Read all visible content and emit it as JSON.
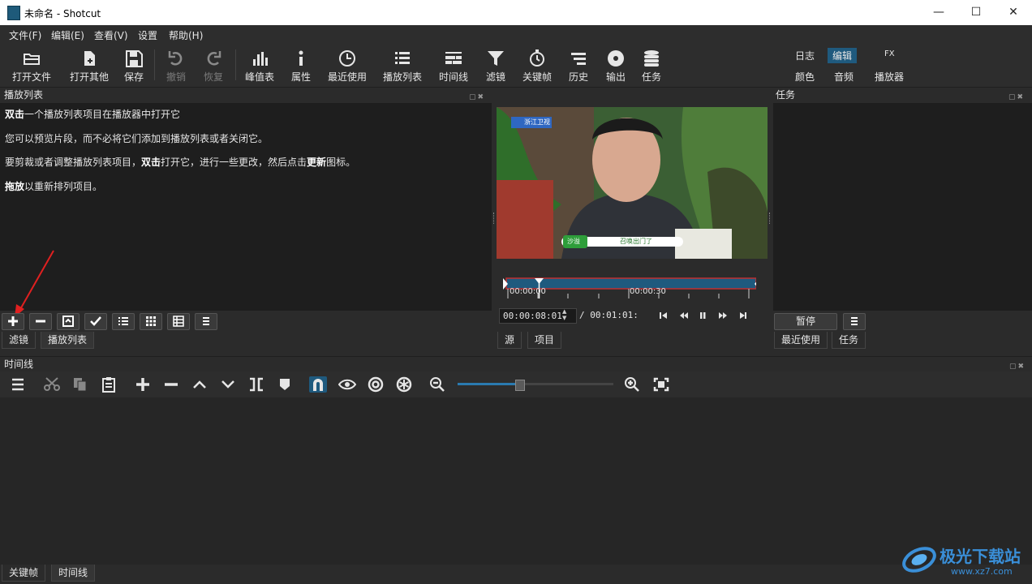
{
  "window": {
    "title": "未命名 - Shotcut"
  },
  "menu": [
    "文件(F)",
    "编辑(E)",
    "查看(V)",
    "设置",
    "帮助(H)"
  ],
  "toolbar": {
    "open_file": "打开文件",
    "open_other": "打开其他",
    "save": "保存",
    "undo": "撤销",
    "redo": "恢复",
    "peak_meter": "峰值表",
    "properties": "属性",
    "recent": "最近使用",
    "playlist": "播放列表",
    "timeline": "时间线",
    "filters": "滤镜",
    "keyframes": "关键帧",
    "history": "历史",
    "export": "输出",
    "jobs": "任务"
  },
  "layouts": {
    "log": "日志",
    "edit": "编辑",
    "fx": "FX",
    "color": "颜色",
    "audio": "音频",
    "player": "播放器"
  },
  "playlist_panel": {
    "title": "播放列表",
    "line1_bold": "双击",
    "line1_rest": "一个播放列表项目在播放器中打开它",
    "line2": "您可以预览片段，而不必将它们添加到播放列表或者关闭它。",
    "line3_a": "要剪裁或者调整播放列表项目，",
    "line3_bold1": "双击",
    "line3_b": "打开它，进行一些更改，然后点击",
    "line3_bold2": "更新",
    "line3_c": "图标。",
    "line4_bold": "拖放",
    "line4_rest": "以重新排列项目。",
    "tabs": [
      "滤镜",
      "播放列表"
    ]
  },
  "player": {
    "logo_text": "浙江卫视",
    "caption_left": "沙溢",
    "caption_right": "召唤出门了",
    "ruler_0": "00:00:00",
    "ruler_1": "00:00:30",
    "position": "00:00:08:01",
    "duration": "/ 00:01:01:",
    "tabs": [
      "源",
      "项目"
    ]
  },
  "tasks_panel": {
    "title": "任务",
    "pause": "暂停",
    "tabs": [
      "最近使用",
      "任务"
    ]
  },
  "timeline_panel": {
    "title": "时间线",
    "tabs": [
      "关键帧",
      "时间线"
    ],
    "zoom_level": 0.4
  },
  "watermark": {
    "text": "极光下载站",
    "url": "www.xz7.com"
  }
}
